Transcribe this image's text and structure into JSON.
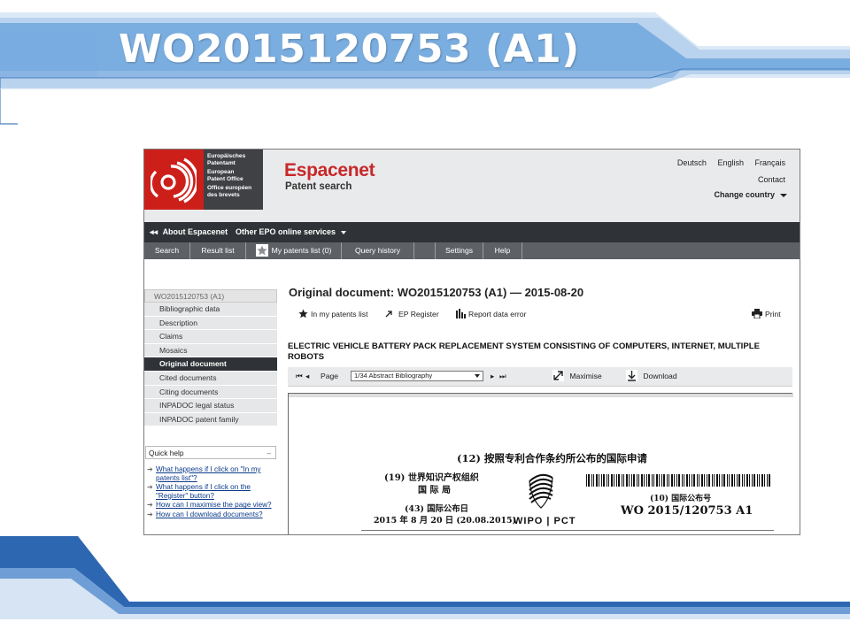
{
  "slide": {
    "title": "WO2015120753 (A1)"
  },
  "header": {
    "logo_lines": [
      "Europäisches",
      "Patentamt",
      "European",
      "Patent Office",
      "Office européen",
      "des brevets"
    ],
    "brand": "Espacenet",
    "brand_sub": "Patent search",
    "languages": [
      "Deutsch",
      "English",
      "Français"
    ],
    "contact": "Contact",
    "change_country": "Change country"
  },
  "darknav": {
    "about": "About Espacenet",
    "other": "Other EPO online services"
  },
  "tabs": [
    "Search",
    "Result list",
    "My patents list (0)",
    "Query history",
    "",
    "Settings",
    "Help"
  ],
  "sidebar": {
    "head": "WO2015120753 (A1)",
    "items": [
      "Bibliographic data",
      "Description",
      "Claims",
      "Mosaics",
      "Original document",
      "Cited documents",
      "Citing documents",
      "INPADOC legal status",
      "INPADOC patent family"
    ],
    "active": "Original document"
  },
  "quick_help": {
    "title": "Quick help",
    "minimize": "–",
    "items": [
      "What happens if I click on \"In my patents list\"?",
      "What happens if I click on the \"Register\" button?",
      "How can I maximise the page view?",
      "How can I download documents?"
    ]
  },
  "main": {
    "title": "Original document: WO2015120753 (A1) — 2015-08-20",
    "actions": {
      "patents_list": "In my patents list",
      "ep_register": "EP Register",
      "report": "Report data error",
      "print": "Print"
    },
    "doc_heading": "ELECTRIC VEHICLE BATTERY PACK REPLACEMENT SYSTEM CONSISTING OF COMPUTERS, INTERNET, MULTIPLE ROBOTS",
    "viewer": {
      "page_label": "Page",
      "page_value": "1/34 Abstract Bibliography",
      "maximise": "Maximise",
      "download": "Download"
    }
  },
  "document_image": {
    "line12": "(12) 按照专利合作条约所公布的国际申请",
    "line19a": "(19) 世界知识产权组织",
    "line19b": "国 际 局",
    "line43": "(43) 国际公布日",
    "date": "2015 年 8 月 20 日 (20.08.2015)",
    "line10": "(10) 国际公布号",
    "pub_number": "WO 2015/120753 A1",
    "wipo": "WIPO | PCT"
  },
  "colors": {
    "brand_red": "#cc1f1a",
    "dark_nav": "#2f3337",
    "slide_blue": "#5b9bd5"
  }
}
